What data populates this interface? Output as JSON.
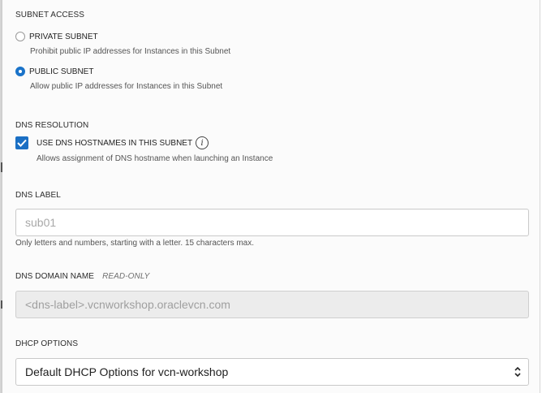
{
  "subnet_access": {
    "title": "SUBNET ACCESS",
    "options": [
      {
        "label": "PRIVATE SUBNET",
        "help": "Prohibit public IP addresses for Instances in this Subnet",
        "selected": false
      },
      {
        "label": "PUBLIC SUBNET",
        "help": "Allow public IP addresses for Instances in this Subnet",
        "selected": true
      }
    ]
  },
  "dns_resolution": {
    "title": "DNS RESOLUTION",
    "checkbox_label": "USE DNS HOSTNAMES IN THIS SUBNET",
    "checked": true,
    "info_icon": "info-icon",
    "help": "Allows assignment of DNS hostname when launching an Instance"
  },
  "dns_label": {
    "title": "DNS LABEL",
    "placeholder": "sub01",
    "help": "Only letters and numbers, starting with a letter. 15 characters max."
  },
  "dns_domain_name": {
    "title": "DNS DOMAIN NAME",
    "readonly_tag": "READ-ONLY",
    "value": "<dns-label>.vcnworkshop.oraclevcn.com"
  },
  "dhcp_options": {
    "title": "DHCP OPTIONS",
    "selected": "Default DHCP Options for vcn-workshop"
  },
  "colors": {
    "accent": "#1a6fc4",
    "readonly_bg": "#ececec"
  }
}
